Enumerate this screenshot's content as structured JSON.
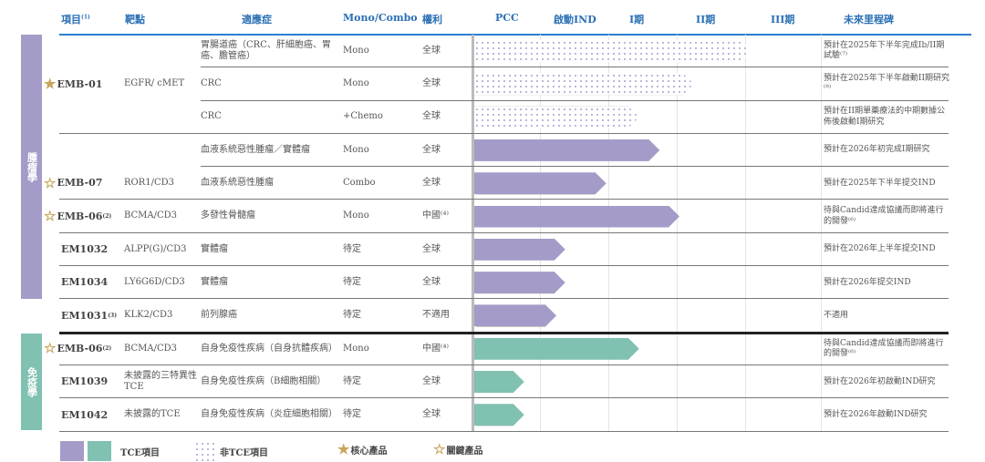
{
  "headers": {
    "project": "項目",
    "project_note": "(1)",
    "target": "靶點",
    "indication": "適應症",
    "mono_combo": "Mono/Combo",
    "rights": "權利",
    "pcc": "PCC",
    "ind": "啟動IND",
    "phase1": "I期",
    "phase2": "II期",
    "phase3": "III期",
    "milestone": "未來里程碑"
  },
  "sections": [
    {
      "label": "腫瘤學",
      "color": "#a49bc8"
    },
    {
      "label": "免疫學",
      "color": "#80c1b2"
    }
  ],
  "colors": {
    "oncology": "#a49bc8",
    "immunology": "#80c1b2",
    "gold": "#c8a55a"
  },
  "rows": [
    {
      "project": "",
      "target": "",
      "indication": "胃腸道癌（CRC、肝細胞癌、胃癌、膽管癌）",
      "mode": "Mono",
      "rights": "全球",
      "stage": 4.1,
      "type": "hatch",
      "milestone": "預計在2025年下半年完成Ib/II期試驗⁽⁷⁾"
    },
    {
      "project": "EMB-01",
      "star": "core",
      "target": "EGFR/ cMET",
      "indication": "CRC",
      "mode": "Mono",
      "rights": "全球",
      "stage": 3.25,
      "type": "hatch",
      "milestone": "預計在2025年下半年啟動II期研究⁽⁸⁾"
    },
    {
      "project": "",
      "target": "",
      "indication": "CRC",
      "mode": "+Chemo",
      "rights": "全球",
      "stage": 2.45,
      "type": "hatch",
      "milestone": "預計在II期單藥療法的中期數據公佈後啟動I期研究"
    },
    {
      "project": "",
      "target": "",
      "indication": "血液系統惡性腫瘤／實體瘤",
      "mode": "Mono",
      "rights": "全球",
      "stage": 2.75,
      "type": "onc",
      "milestone": "預計在2026年初完成I期研究"
    },
    {
      "project": "EMB-07",
      "star": "key",
      "target": "ROR1/CD3",
      "indication": "血液系統惡性腫瘤",
      "mode": "Combo",
      "rights": "全球",
      "stage": 1.97,
      "type": "onc",
      "milestone": "預計在2025年下半年提交IND"
    },
    {
      "project": "EMB-06",
      "note": "(2)",
      "star": "key",
      "target": "BCMA/CD3",
      "indication": "多發性骨髓瘤",
      "mode": "Mono",
      "rights": "中國⁽⁴⁾",
      "stage": 3.04,
      "type": "onc",
      "milestone": "待與Candid達成協議而即將進行的開發⁽⁶⁾"
    },
    {
      "project": "EM1032",
      "target": "ALPP(G)/CD3",
      "indication": "實體瘤",
      "mode": "待定",
      "rights": "全球",
      "stage": 1.37,
      "type": "onc",
      "milestone": "預計在2026年上半年提交IND"
    },
    {
      "project": "EM1034",
      "target": "LY6G6D/CD3",
      "indication": "實體瘤",
      "mode": "待定",
      "rights": "全球",
      "stage": 1.37,
      "type": "onc",
      "milestone": "預計在2026年提交IND"
    },
    {
      "project": "EM1031",
      "note": "(3)",
      "target": "KLK2/CD3",
      "indication": "前列腺癌",
      "mode": "待定",
      "rights": "不適用",
      "stage": 1.24,
      "type": "onc",
      "milestone": "不適用"
    },
    {
      "project": "EMB-06",
      "note": "(2)",
      "star": "key",
      "target": "BCMA/CD3",
      "indication": "自身免疫性疾病（自身抗體疾病）",
      "mode": "Mono",
      "rights": "中國⁽⁴⁾",
      "stage": 2.45,
      "type": "imm",
      "milestone": "待與Candid達成協議而即將進行的開發⁽⁶⁾"
    },
    {
      "project": "EM1039",
      "target": "未披露的三特異性TCE",
      "indication": "自身免疫性疾病（B細胞相關）",
      "mode": "待定",
      "rights": "全球",
      "stage": 0.77,
      "type": "imm",
      "milestone": "預計在2026年初啟動IND研究"
    },
    {
      "project": "EM1042",
      "target": "未披露的TCE",
      "indication": "自身免疫性疾病（炎症細胞相關）",
      "mode": "待定",
      "rights": "全球",
      "stage": 0.77,
      "type": "imm",
      "milestone": "預計在2026年啟動IND研究"
    }
  ],
  "legend": {
    "tce": "TCE項目",
    "non_tce": "非TCE項目",
    "core": "核心產品",
    "key": "關鍵產品"
  },
  "stars": {
    "core": "★",
    "key": "☆"
  }
}
